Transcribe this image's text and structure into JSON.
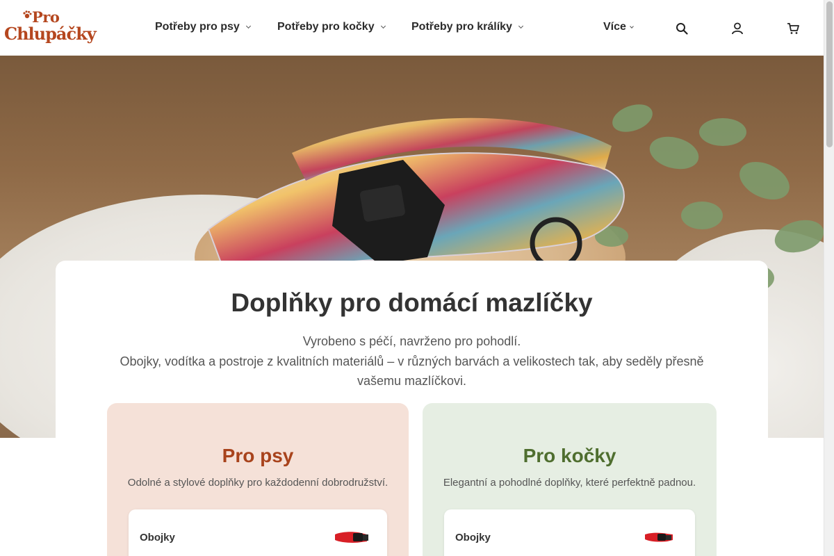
{
  "brand": {
    "line1": "Pro",
    "line2": "Chlupáčky"
  },
  "nav": [
    {
      "label": "Potřeby pro psy"
    },
    {
      "label": "Potřeby pro kočky"
    },
    {
      "label": "Potřeby pro králíky"
    },
    {
      "label": "Více"
    }
  ],
  "header_icons": [
    "search-icon",
    "user-icon",
    "cart-icon"
  ],
  "hero": {
    "headline": "Doplňky pro domácí mazlíčky",
    "subline1": "Vyrobeno s péčí, navrženo pro pohodlí.",
    "subline2": "Obojky, vodítka a postroje z kvalitních materiálů – v různých barvách a velikostech tak, aby seděly přesně vašemu mazlíčkovi."
  },
  "categories": [
    {
      "title": "Pro psy",
      "description": "Odolné a stylové doplňky pro každodenní dobrodružství.",
      "products": [
        {
          "name": "Obojky"
        }
      ]
    },
    {
      "title": "Pro kočky",
      "description": "Elegantní a pohodlné doplňky, které perfektně padnou.",
      "products": [
        {
          "name": "Obojky"
        }
      ]
    }
  ],
  "colors": {
    "brand": "#b5471f",
    "dog_accent": "#a8431c",
    "cat_accent": "#4f6e2f",
    "dog_bg": "#f5e1d8",
    "cat_bg": "#e6eee3",
    "collar_red": "#d81f26"
  }
}
